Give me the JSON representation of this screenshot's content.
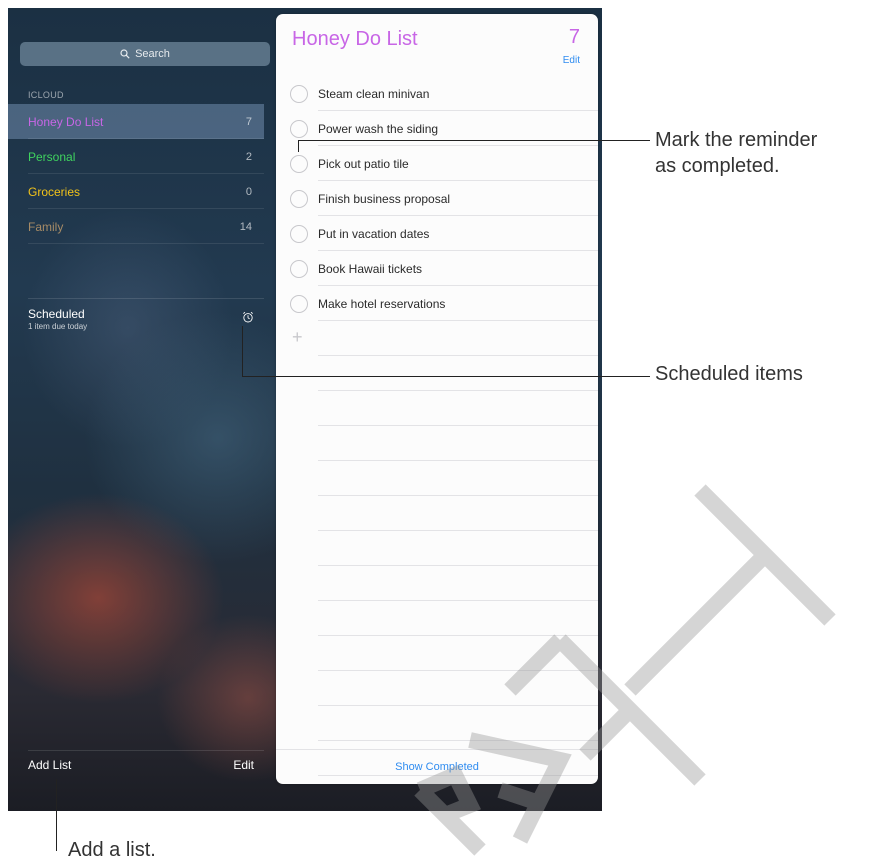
{
  "sidebar": {
    "search_placeholder": "Search",
    "section_header": "ICLOUD",
    "lists": [
      {
        "name": "Honey Do List",
        "count": "7",
        "color": "#c866e6",
        "selected": true
      },
      {
        "name": "Personal",
        "count": "2",
        "color": "#3fd35f",
        "selected": false
      },
      {
        "name": "Groceries",
        "count": "0",
        "color": "#f2c31a",
        "selected": false
      },
      {
        "name": "Family",
        "count": "14",
        "color": "#a68b66",
        "selected": false
      }
    ],
    "scheduled": {
      "title": "Scheduled",
      "subtitle": "1 item due today",
      "icon": "alarm-clock-icon"
    },
    "add_list_label": "Add List",
    "edit_label": "Edit"
  },
  "list_view": {
    "title": "Honey Do List",
    "count": "7",
    "edit_label": "Edit",
    "accent_color": "#c866e6",
    "items": [
      "Steam clean minivan",
      "Power wash the siding",
      "Pick out patio tile",
      "Finish business proposal",
      "Put in vacation dates",
      "Book Hawaii tickets",
      "Make hotel reservations"
    ],
    "show_completed_label": "Show Completed"
  },
  "callouts": {
    "mark_completed_line1": "Mark the reminder",
    "mark_completed_line2": "as completed.",
    "scheduled_items": "Scheduled items",
    "add_list": "Add a list."
  },
  "watermark": "DRAFT"
}
